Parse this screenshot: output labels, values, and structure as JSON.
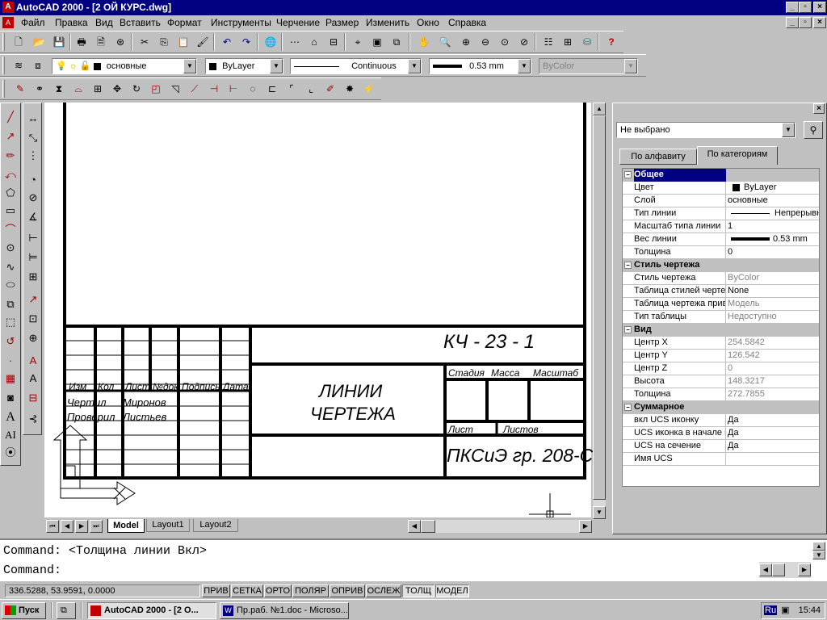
{
  "window": {
    "title": "AutoCAD 2000 - [2 ОЙ КУРС.dwg]"
  },
  "menu": [
    "Файл",
    "Правка",
    "Вид",
    "Вставить",
    "Формат",
    "Инструменты",
    "Черчение",
    "Размер",
    "Изменить",
    "Окно",
    "Справка"
  ],
  "layer_bar": {
    "layer": "основные",
    "color": "ByLayer",
    "linetype": "Continuous",
    "lineweight": "0.53 mm",
    "plotstyle": "ByColor"
  },
  "drawing": {
    "title_block": {
      "code": "КЧ - 23 - 1",
      "name_line1": "ЛИНИИ",
      "name_line2": "ЧЕРТЕЖА",
      "group": "ПКСиЭ гр. 208-С",
      "headers": [
        "Изм",
        "Кол",
        "Лист",
        "№док",
        "Подпись",
        "Дата"
      ],
      "stage_headers": [
        "Стадия",
        "Масса",
        "Масштаб"
      ],
      "sheet_labels": [
        "Лист",
        "Листов"
      ],
      "rows": [
        {
          "role": "Чертил",
          "name": "Миронов"
        },
        {
          "role": "Проверил",
          "name": "Листьев"
        }
      ]
    }
  },
  "layout_tabs": [
    "Model",
    "Layout1",
    "Layout2"
  ],
  "properties": {
    "selection": "Не выбрано",
    "tabs": [
      "По алфавиту",
      "По категориям"
    ],
    "categories": [
      {
        "name": "Общее",
        "rows": [
          {
            "k": "Цвет",
            "v": "ByLayer",
            "swatch": true
          },
          {
            "k": "Слой",
            "v": "основные"
          },
          {
            "k": "Тип линии",
            "v": "Непрерывн",
            "line": true
          },
          {
            "k": "Масштаб типа линии",
            "v": "1"
          },
          {
            "k": "Вес линии",
            "v": "0.53 mm",
            "thick": true
          },
          {
            "k": "Толщина",
            "v": "0"
          }
        ]
      },
      {
        "name": "Стиль чертежа",
        "rows": [
          {
            "k": "Стиль чертежа",
            "v": "ByColor",
            "grey": true
          },
          {
            "k": "Таблица стилей черте",
            "v": "None"
          },
          {
            "k": "Таблица чертежа прив",
            "v": "Модель",
            "grey": true
          },
          {
            "k": "Тип таблицы",
            "v": "Недоступно",
            "grey": true
          }
        ]
      },
      {
        "name": "Вид",
        "rows": [
          {
            "k": "Центр X",
            "v": "254.5842",
            "grey": true
          },
          {
            "k": "Центр Y",
            "v": "126.542",
            "grey": true
          },
          {
            "k": "Центр Z",
            "v": "0",
            "grey": true
          },
          {
            "k": "Высота",
            "v": "148.3217",
            "grey": true
          },
          {
            "k": "Толщина",
            "v": "272.7855",
            "grey": true
          }
        ]
      },
      {
        "name": "Суммарное",
        "rows": [
          {
            "k": "вкл UCS иконку",
            "v": "Да"
          },
          {
            "k": "UCS иконка в начале к",
            "v": "Да"
          },
          {
            "k": "UCS на сечение",
            "v": "Да"
          },
          {
            "k": "Имя UCS",
            "v": ""
          }
        ]
      }
    ]
  },
  "command": {
    "history": "Command:  <Толщина линии Вкл>",
    "prompt": "Command:"
  },
  "status": {
    "coords": "336.5288, 53.9591, 0.0000",
    "toggles": [
      "ПРИВ",
      "СЕТКА",
      "ОРТО",
      "ПОЛЯР",
      "ОПРИВ",
      "ОСЛЕЖ",
      "ТОЛЩ",
      "МОДЕЛ"
    ]
  },
  "taskbar": {
    "start": "Пуск",
    "tasks": [
      "AutoCAD 2000 - [2 О...",
      "Пр.раб. №1.doc - Microso..."
    ],
    "lang": "Ru",
    "clock": "15:44"
  }
}
